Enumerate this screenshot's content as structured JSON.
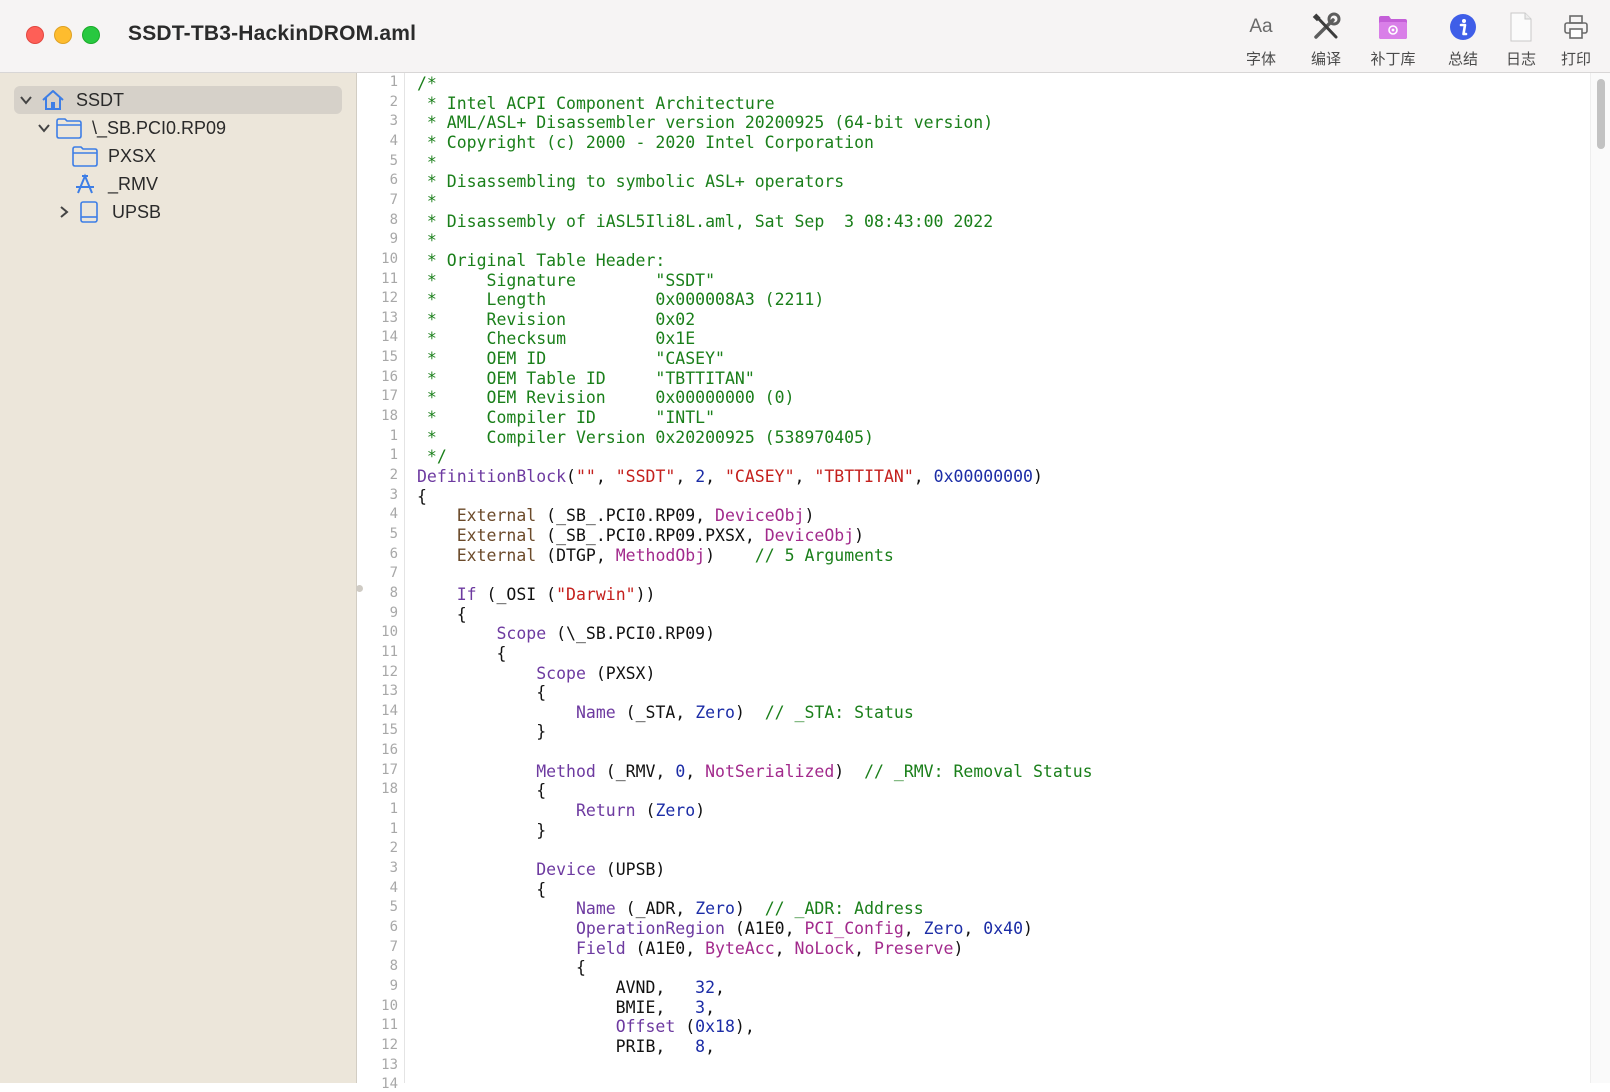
{
  "window": {
    "title": "SSDT-TB3-HackinDROM.aml"
  },
  "toolbar": {
    "items": [
      {
        "label": "字体",
        "icon": "font-icon"
      },
      {
        "label": "编译",
        "icon": "tools-icon"
      },
      {
        "label": "补丁库",
        "icon": "patch-folder-icon"
      },
      {
        "label": "总结",
        "icon": "info-icon"
      },
      {
        "label": "日志",
        "icon": "document-icon"
      },
      {
        "label": "打印",
        "icon": "printer-icon"
      }
    ],
    "font_glyph": "Aa"
  },
  "sidebar": {
    "items": [
      {
        "label": "SSDT",
        "icon": "house-icon",
        "expanded": true,
        "selected": true
      },
      {
        "label": "\\_SB.PCI0.RP09",
        "icon": "folder-icon",
        "expanded": true
      },
      {
        "label": "PXSX",
        "icon": "folder-icon"
      },
      {
        "label": "_RMV",
        "icon": "method-icon"
      },
      {
        "label": "UPSB",
        "icon": "device-icon",
        "expanded": false
      }
    ]
  },
  "editor": {
    "line_numbers": [
      "1",
      "2",
      "3",
      "4",
      "5",
      "6",
      "7",
      "8",
      "9",
      "10",
      "11",
      "12",
      "13",
      "14",
      "15",
      "16",
      "17",
      "18",
      "1",
      "1",
      "2",
      "3",
      "4",
      "5",
      "6",
      "7",
      "8",
      "9",
      "10",
      "11",
      "12",
      "13",
      "14",
      "15",
      "16",
      "17",
      "18",
      "1",
      "1",
      "2",
      "3",
      "4",
      "5",
      "6",
      "7",
      "8",
      "9",
      "10",
      "11",
      "12",
      "13",
      "14"
    ],
    "lines": [
      [
        [
          "c-com",
          "/*"
        ]
      ],
      [
        [
          "c-com",
          " * Intel ACPI Component Architecture"
        ]
      ],
      [
        [
          "c-com",
          " * AML/ASL+ Disassembler version 20200925 (64-bit version)"
        ]
      ],
      [
        [
          "c-com",
          " * Copyright (c) 2000 - 2020 Intel Corporation"
        ]
      ],
      [
        [
          "c-com",
          " *"
        ]
      ],
      [
        [
          "c-com",
          " * Disassembling to symbolic ASL+ operators"
        ]
      ],
      [
        [
          "c-com",
          " *"
        ]
      ],
      [
        [
          "c-com",
          " * Disassembly of iASL5Ili8L.aml, Sat Sep  3 08:43:00 2022"
        ]
      ],
      [
        [
          "c-com",
          " *"
        ]
      ],
      [
        [
          "c-com",
          " * Original Table Header:"
        ]
      ],
      [
        [
          "c-com",
          " *     Signature        \"SSDT\""
        ]
      ],
      [
        [
          "c-com",
          " *     Length           0x000008A3 (2211)"
        ]
      ],
      [
        [
          "c-com",
          " *     Revision         0x02"
        ]
      ],
      [
        [
          "c-com",
          " *     Checksum         0x1E"
        ]
      ],
      [
        [
          "c-com",
          " *     OEM ID           \"CASEY\""
        ]
      ],
      [
        [
          "c-com",
          " *     OEM Table ID     \"TBTTITAN\""
        ]
      ],
      [
        [
          "c-com",
          " *     OEM Revision     0x00000000 (0)"
        ]
      ],
      [
        [
          "c-com",
          " *     Compiler ID      \"INTL\""
        ]
      ],
      [
        [
          "c-com",
          " *     Compiler Version 0x20200925 (538970405)"
        ]
      ],
      [
        [
          "c-com",
          " */"
        ]
      ],
      [
        [
          "c-kw",
          "DefinitionBlock"
        ],
        [
          "",
          "("
        ],
        [
          "c-str",
          "\"\""
        ],
        [
          "",
          ", "
        ],
        [
          "c-str",
          "\"SSDT\""
        ],
        [
          "",
          ", "
        ],
        [
          "c-num",
          "2"
        ],
        [
          "",
          ", "
        ],
        [
          "c-str",
          "\"CASEY\""
        ],
        [
          "",
          ", "
        ],
        [
          "c-str",
          "\"TBTTITAN\""
        ],
        [
          "",
          ", "
        ],
        [
          "c-num",
          "0x00000000"
        ],
        [
          "",
          ")"
        ]
      ],
      [
        [
          "",
          "{"
        ]
      ],
      [
        [
          "",
          "    "
        ],
        [
          "c-ext",
          "External"
        ],
        [
          "",
          " (_SB_.PCI0.RP09, "
        ],
        [
          "c-typ",
          "DeviceObj"
        ],
        [
          "",
          ")"
        ]
      ],
      [
        [
          "",
          "    "
        ],
        [
          "c-ext",
          "External"
        ],
        [
          "",
          " (_SB_.PCI0.RP09.PXSX, "
        ],
        [
          "c-typ",
          "DeviceObj"
        ],
        [
          "",
          ")"
        ]
      ],
      [
        [
          "",
          "    "
        ],
        [
          "c-ext",
          "External"
        ],
        [
          "",
          " (DTGP, "
        ],
        [
          "c-typ",
          "MethodObj"
        ],
        [
          "",
          ")    "
        ],
        [
          "c-com",
          "// 5 Arguments"
        ]
      ],
      [
        [
          "",
          ""
        ]
      ],
      [
        [
          "",
          "    "
        ],
        [
          "c-kw",
          "If"
        ],
        [
          "",
          " (_OSI ("
        ],
        [
          "c-str",
          "\"Darwin\""
        ],
        [
          "",
          "))"
        ]
      ],
      [
        [
          "",
          "    {"
        ]
      ],
      [
        [
          "",
          "        "
        ],
        [
          "c-kw",
          "Scope"
        ],
        [
          "",
          " (\\_SB.PCI0.RP09)"
        ]
      ],
      [
        [
          "",
          "        {"
        ]
      ],
      [
        [
          "",
          "            "
        ],
        [
          "c-kw",
          "Scope"
        ],
        [
          "",
          " (PXSX)"
        ]
      ],
      [
        [
          "",
          "            {"
        ]
      ],
      [
        [
          "",
          "                "
        ],
        [
          "c-kw",
          "Name"
        ],
        [
          "",
          " (_STA, "
        ],
        [
          "c-num",
          "Zero"
        ],
        [
          "",
          ")  "
        ],
        [
          "c-com",
          "// _STA: Status"
        ]
      ],
      [
        [
          "",
          "            }"
        ]
      ],
      [
        [
          "",
          ""
        ]
      ],
      [
        [
          "",
          "            "
        ],
        [
          "c-kw",
          "Method"
        ],
        [
          "",
          " (_RMV, "
        ],
        [
          "c-num",
          "0"
        ],
        [
          "",
          ", "
        ],
        [
          "c-typ",
          "NotSerialized"
        ],
        [
          "",
          ")  "
        ],
        [
          "c-com",
          "// _RMV: Removal Status"
        ]
      ],
      [
        [
          "",
          "            {"
        ]
      ],
      [
        [
          "",
          "                "
        ],
        [
          "c-kw",
          "Return"
        ],
        [
          "",
          " ("
        ],
        [
          "c-num",
          "Zero"
        ],
        [
          "",
          ")"
        ]
      ],
      [
        [
          "",
          "            }"
        ]
      ],
      [
        [
          "",
          ""
        ]
      ],
      [
        [
          "",
          "            "
        ],
        [
          "c-kw",
          "Device"
        ],
        [
          "",
          " (UPSB)"
        ]
      ],
      [
        [
          "",
          "            {"
        ]
      ],
      [
        [
          "",
          "                "
        ],
        [
          "c-kw",
          "Name"
        ],
        [
          "",
          " (_ADR, "
        ],
        [
          "c-num",
          "Zero"
        ],
        [
          "",
          ")  "
        ],
        [
          "c-com",
          "// _ADR: Address"
        ]
      ],
      [
        [
          "",
          "                "
        ],
        [
          "c-kw",
          "OperationRegion"
        ],
        [
          "",
          " (A1E0, "
        ],
        [
          "c-typ",
          "PCI_Config"
        ],
        [
          "",
          ", "
        ],
        [
          "c-num",
          "Zero"
        ],
        [
          "",
          ", "
        ],
        [
          "c-num",
          "0x40"
        ],
        [
          "",
          ")"
        ]
      ],
      [
        [
          "",
          "                "
        ],
        [
          "c-kw",
          "Field"
        ],
        [
          "",
          " (A1E0, "
        ],
        [
          "c-typ",
          "ByteAcc"
        ],
        [
          "",
          ", "
        ],
        [
          "c-typ",
          "NoLock"
        ],
        [
          "",
          ", "
        ],
        [
          "c-typ",
          "Preserve"
        ],
        [
          "",
          ")"
        ]
      ],
      [
        [
          "",
          "                {"
        ]
      ],
      [
        [
          "",
          "                    AVND,   "
        ],
        [
          "c-num",
          "32"
        ],
        [
          "",
          ","
        ]
      ],
      [
        [
          "",
          "                    BMIE,   "
        ],
        [
          "c-num",
          "3"
        ],
        [
          "",
          ","
        ]
      ],
      [
        [
          "",
          "                    "
        ],
        [
          "c-kw",
          "Offset"
        ],
        [
          "",
          " ("
        ],
        [
          "c-num",
          "0x18"
        ],
        [
          "",
          "),"
        ]
      ],
      [
        [
          "",
          "                    PRIB,   "
        ],
        [
          "c-num",
          "8"
        ],
        [
          "",
          ","
        ]
      ]
    ]
  }
}
